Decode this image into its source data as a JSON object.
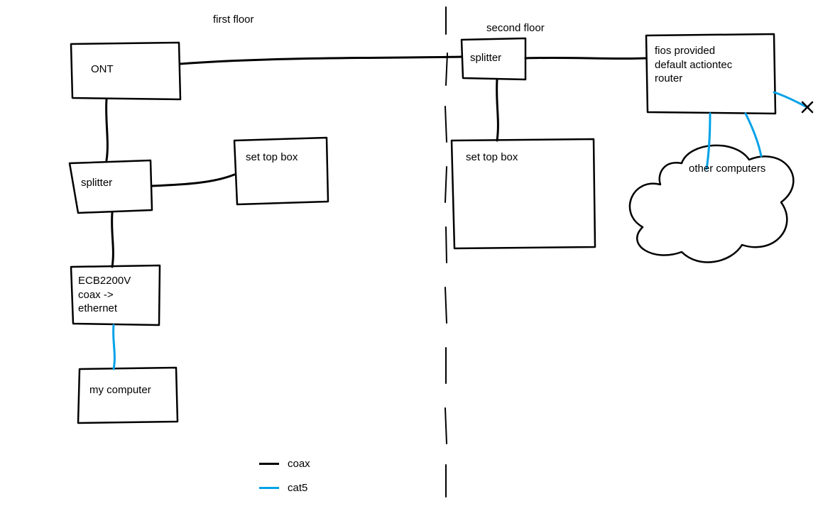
{
  "sections": {
    "first_floor": "first floor",
    "second_floor": "second floor"
  },
  "nodes": {
    "ont": "ONT",
    "splitter1": "splitter",
    "settop1": "set top box",
    "ecb": "ECB2200V\ncoax ->\nethernet",
    "mycomputer": "my computer",
    "splitter2": "splitter",
    "settop2": "set top box",
    "router": "fios provided\ndefault actiontec\nrouter",
    "other": "other computers"
  },
  "legend": {
    "coax": "coax",
    "cat5": "cat5"
  },
  "colors": {
    "coax": "#000000",
    "cat5": "#00a2e8"
  }
}
